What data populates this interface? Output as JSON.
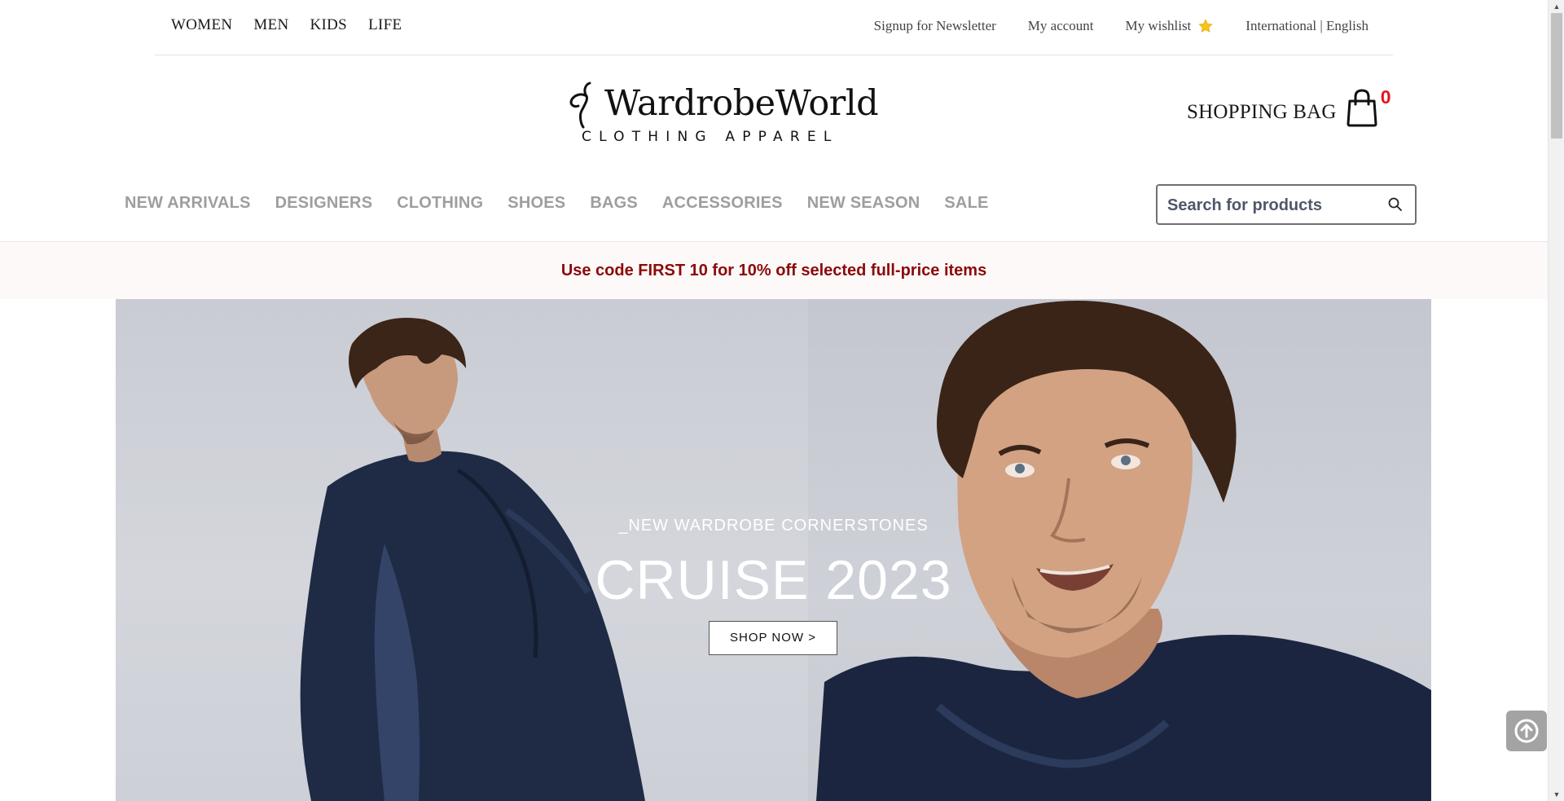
{
  "utility": {
    "gender_links": [
      "WOMEN",
      "MEN",
      "KIDS",
      "LIFE"
    ],
    "newsletter": "Signup for Newsletter",
    "account": "My account",
    "wishlist": "My wishlist",
    "locale": "International | English"
  },
  "logo": {
    "name": "WardrobeWorld",
    "tagline": "CLOTHING APPAREL"
  },
  "bag": {
    "label": "SHOPPING BAG",
    "count": "0"
  },
  "categories": [
    "NEW ARRIVALS",
    "DESIGNERS",
    "CLOTHING",
    "SHOES",
    "BAGS",
    "ACCESSORIES",
    "NEW SEASON",
    "SALE"
  ],
  "search": {
    "placeholder": "Search for products"
  },
  "promo": {
    "text": "Use code FIRST 10 for 10% off selected full-price items"
  },
  "hero": {
    "kicker": "_NEW WARDROBE CORNERSTONES",
    "title": "CRUISE 2023",
    "cta": "SHOP NOW >"
  },
  "icons": {
    "wishlist": "star-icon",
    "bag": "shopping-bag-icon",
    "search": "search-icon",
    "back_to_top": "arrow-up-circle-icon"
  },
  "colors": {
    "bag_count": "#e8141c",
    "promo_text": "#8b0a0a",
    "category_text": "#9e9e9e",
    "wishlist_star": "#f5c518",
    "back_to_top_bg": "#a3a3a3"
  }
}
